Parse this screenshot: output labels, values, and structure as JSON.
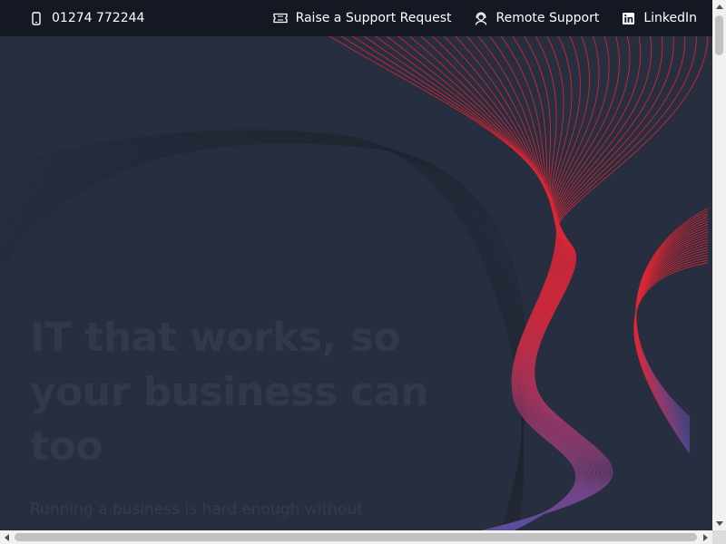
{
  "topbar": {
    "phone": {
      "icon": "mobile-phone-icon",
      "label": "01274 772244"
    },
    "links": [
      {
        "icon": "ticket-icon",
        "label": "Raise a Support Request"
      },
      {
        "icon": "support-agent-icon",
        "label": "Remote Support"
      },
      {
        "icon": "linkedin-icon",
        "label": "LinkedIn"
      }
    ]
  },
  "hero": {
    "headline": "IT that works, so your business can too",
    "subtext": "Running a business is hard enough without"
  },
  "colors": {
    "topbar_bg": "#141823",
    "hero_bg": "#272e40",
    "wave_red": "#e0242e",
    "wave_purple": "#5a4ea0"
  }
}
